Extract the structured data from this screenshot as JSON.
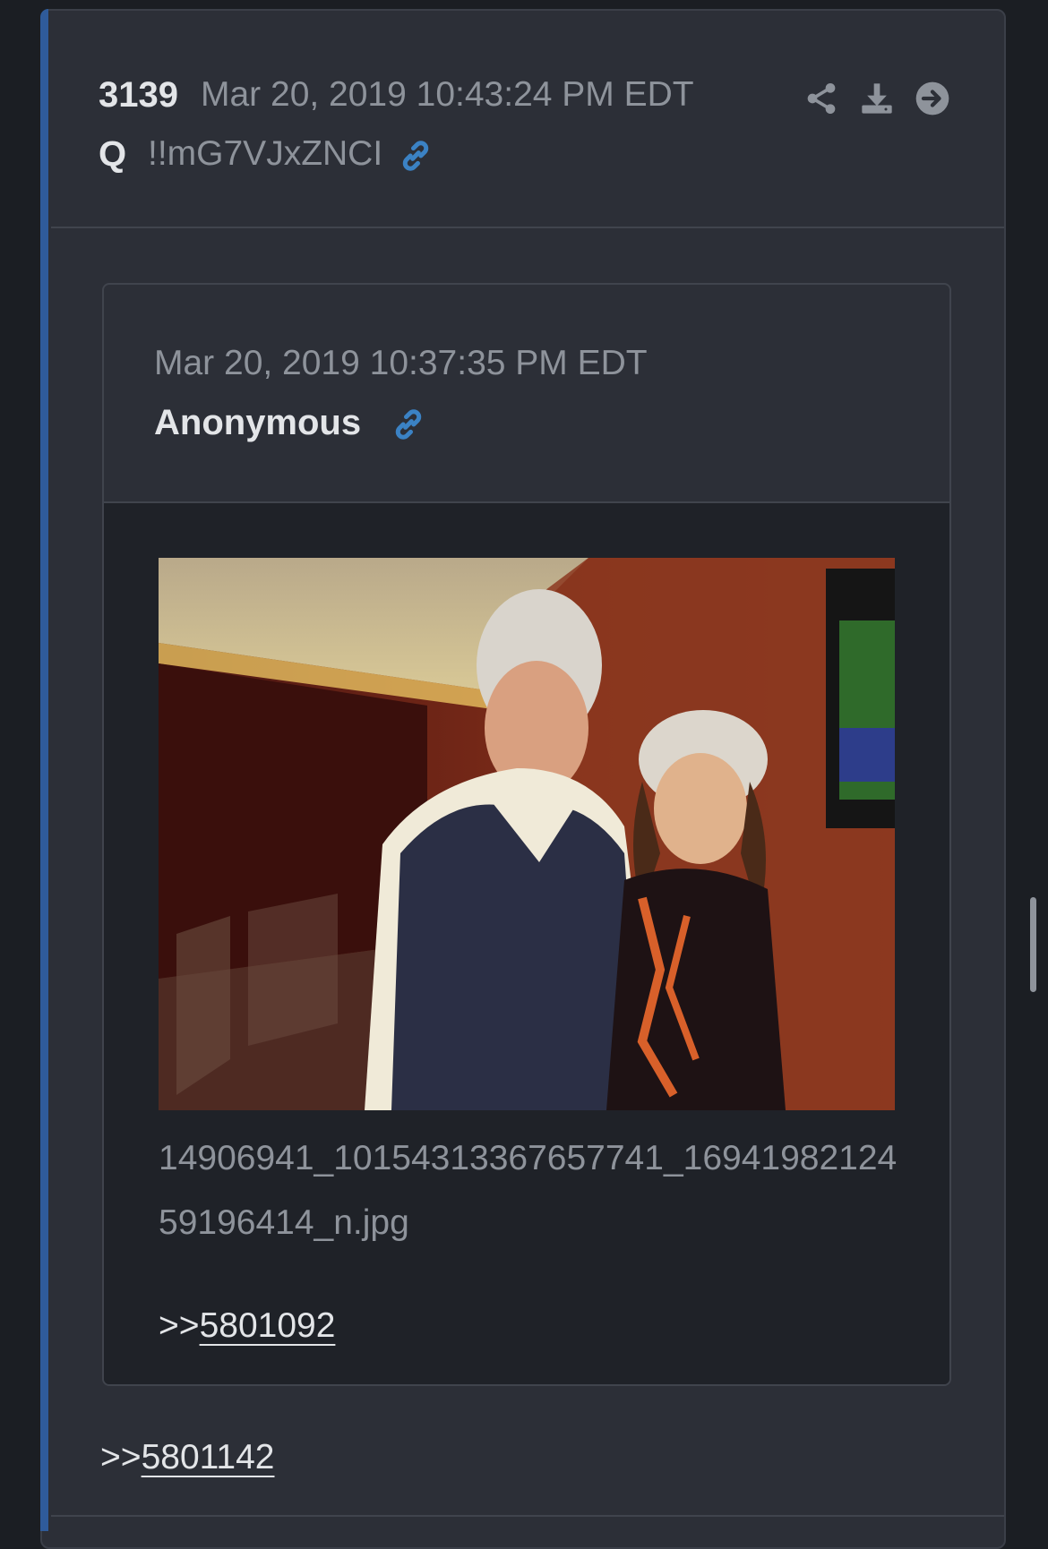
{
  "post": {
    "number": "3139",
    "date": "Mar 20, 2019 10:43:24 PM EDT",
    "author": "Q",
    "tripcode": "!!mG7VJxZNCI",
    "actions": [
      "share-icon",
      "download-icon",
      "arrow-right-circle-icon"
    ],
    "reply_prefix": ">>",
    "reply_ref": "5801142"
  },
  "quoted": {
    "date": "Mar 20, 2019 10:37:35 PM EDT",
    "author": "Anonymous",
    "image_filename": "14906941_10154313367657741_1694198212459196414_n.jpg",
    "reply_prefix": ">>",
    "reply_ref": "5801092"
  },
  "colors": {
    "background": "#1b1e23",
    "card": "#2c2f37",
    "accent": "#2f5b9a",
    "link_icon": "#3b82c4",
    "muted_text": "#8e939b",
    "primary_text": "#e3e5e8"
  }
}
